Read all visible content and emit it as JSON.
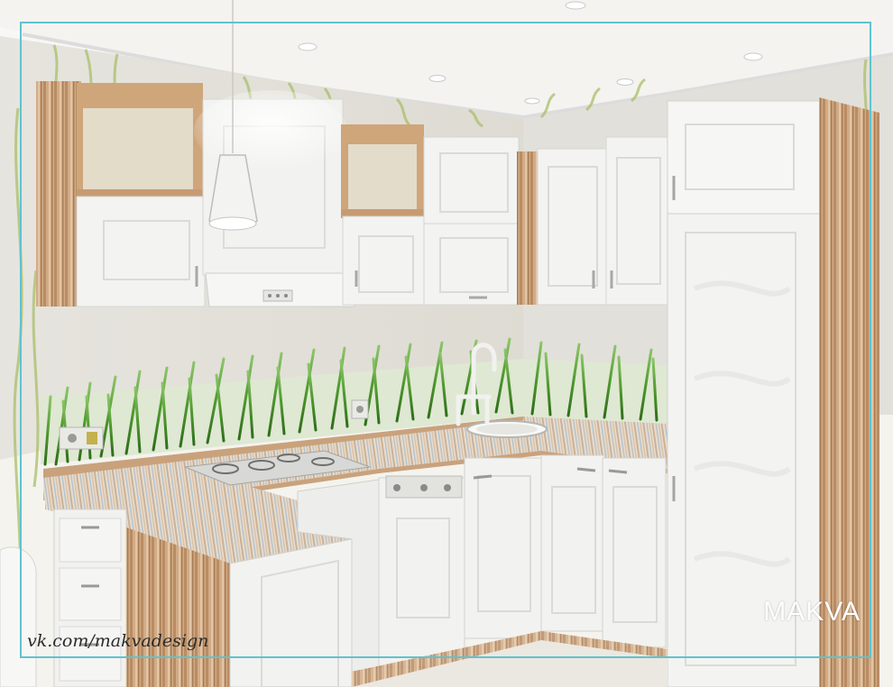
{
  "watermark": {
    "brand": "MAKVA",
    "url": "vk.com/makvadesign"
  },
  "colors": {
    "frame": "#5fc3cf",
    "wood": "#c9a27c",
    "cabinet_white": "#f3f3f1",
    "grass": "#4f9a2f",
    "ceiling": "#f7f7f5"
  },
  "icons": [
    "pendant-lamp-icon",
    "faucet-icon",
    "gas-cooktop-icon",
    "sink-icon"
  ]
}
